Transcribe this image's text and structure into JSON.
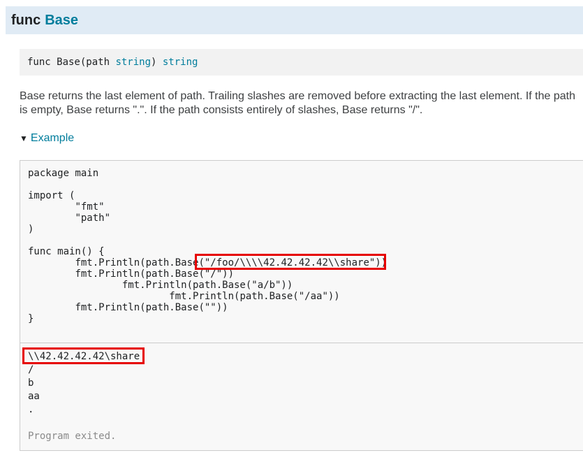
{
  "header": {
    "keyword": "func",
    "name": "Base"
  },
  "signature": {
    "prefix": "func Base(path ",
    "param_type": "string",
    "middle": ") ",
    "return_type": "string"
  },
  "description": "Base returns the last element of path. Trailing slashes are removed before extracting the last element. If the path is empty, Base returns \".\". If the path consists entirely of slashes, Base returns \"/\".",
  "example": {
    "toggle_icon": "triangle-down-icon",
    "label": "Example"
  },
  "code_lines": [
    "package main",
    "",
    "import (",
    "\t\"fmt\"",
    "\t\"path\"",
    ")",
    "",
    "func main() {",
    "\tfmt.Println(path.Base(\"/foo/\\\\\\\\42.42.42.42\\\\share\"))",
    "\tfmt.Println(path.Base(\"/\"))",
    "\t\tfmt.Println(path.Base(\"a/b\"))",
    "\t\t\tfmt.Println(path.Base(\"/aa\"))",
    "\tfmt.Println(path.Base(\"\"))",
    "}"
  ],
  "output_lines": [
    "\\\\42.42.42.42\\share",
    "/",
    "b",
    "aa",
    "."
  ],
  "status": "Program exited.",
  "colors": {
    "header_bg": "#e0ebf5",
    "link": "#007d9c",
    "highlight": "#e60000"
  }
}
